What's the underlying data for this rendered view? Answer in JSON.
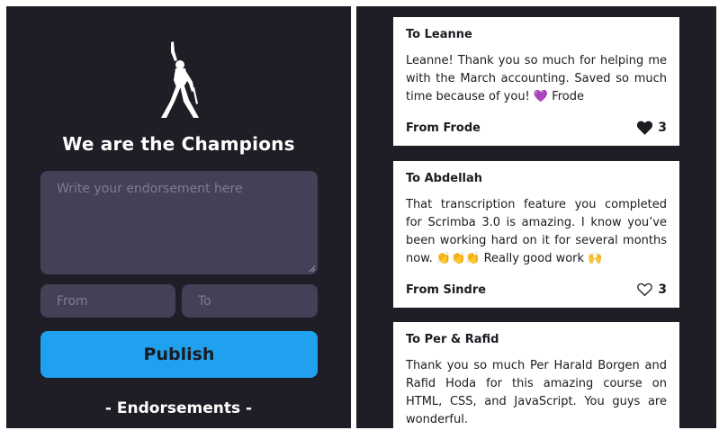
{
  "app": {
    "title": "We are the Champions",
    "colors": {
      "background": "#1f1d26",
      "input": "#444058",
      "accent": "#1fa1f0"
    }
  },
  "form": {
    "endorsement_placeholder": "Write your endorsement here",
    "from_placeholder": "From",
    "to_placeholder": "To",
    "publish_label": "Publish"
  },
  "section_heading": "- Endorsements -",
  "endorsements": [
    {
      "to": "To Leanne",
      "message": "Leanne! Thank you so much for helping me with the March accounting. Saved so much time because of you! 💜 Frode",
      "from": "From Frode",
      "likes": "3",
      "liked": true
    },
    {
      "to": "To Abdellah",
      "message": "That transcription feature you completed for Scrimba 3.0 is amazing. I know you’ve been working hard on it for several months now. 👏👏👏 Really good work 🙌",
      "from": "From Sindre",
      "likes": "3",
      "liked": false
    },
    {
      "to": "To Per & Rafid",
      "message": "Thank you so much Per Harald Borgen and Rafid Hoda for this amazing course on HTML, CSS, and JavaScript. You guys are wonderful.",
      "from": "",
      "likes": "",
      "liked": false
    }
  ],
  "icons": {
    "logo": "freddie-mercury-silhouette-icon",
    "like": "heart-icon"
  }
}
